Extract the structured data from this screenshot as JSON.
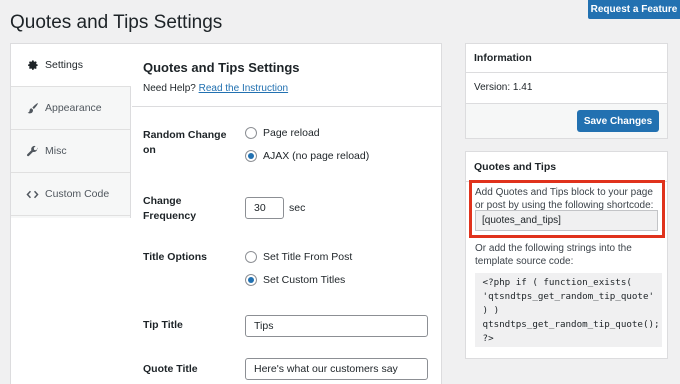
{
  "page_title": "Quotes and Tips Settings",
  "request_feature": "Request a Feature",
  "sidebar": {
    "items": [
      {
        "label": "Settings",
        "icon": "gear-icon",
        "active": true
      },
      {
        "label": "Appearance",
        "icon": "brush-icon",
        "active": false
      },
      {
        "label": "Misc",
        "icon": "wrench-icon",
        "active": false
      },
      {
        "label": "Custom Code",
        "icon": "code-icon",
        "active": false
      }
    ]
  },
  "main": {
    "title": "Quotes and Tips Settings",
    "help_prefix": "Need Help?",
    "help_link": "Read the Instruction",
    "random_change": {
      "label": "Random Change on",
      "options": [
        {
          "label": "Page reload",
          "checked": false
        },
        {
          "label": "AJAX (no page reload)",
          "checked": true
        }
      ]
    },
    "change_frequency": {
      "label": "Change Frequency",
      "value": "30",
      "unit": "sec"
    },
    "title_options": {
      "label": "Title Options",
      "options": [
        {
          "label": "Set Title From Post",
          "checked": false
        },
        {
          "label": "Set Custom Titles",
          "checked": true
        }
      ]
    },
    "tip_title": {
      "label": "Tip Title",
      "value": "Tips"
    },
    "quote_title": {
      "label": "Quote Title",
      "value": "Here's what our customers say"
    }
  },
  "information": {
    "heading": "Information",
    "version_label": "Version:",
    "version": "1.41",
    "save_label": "Save Changes"
  },
  "quotes_box": {
    "heading": "Quotes and Tips",
    "desc": "Add Quotes and Tips block to your page or post by using the following shortcode:",
    "shortcode": "[quotes_and_tips]",
    "desc2": "Or add the following strings into the template source code:",
    "code": " <?php if ( function_exists(\n 'qtsndtps_get_random_tip_quote'\n ) )\n qtsndtps_get_random_tip_quote();\n ?>"
  },
  "colors": {
    "accent": "#2271b1",
    "highlight": "#e0321c"
  }
}
